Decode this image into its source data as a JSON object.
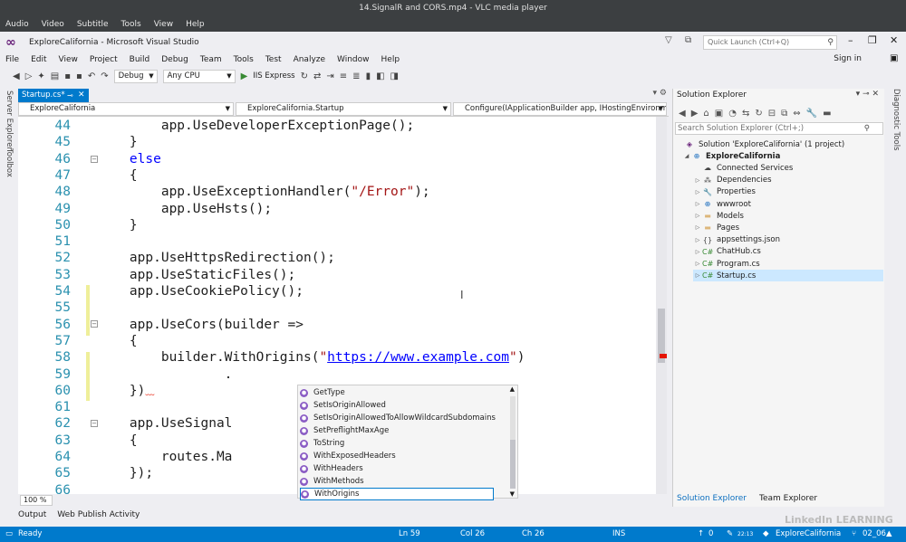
{
  "vlc": {
    "title": "14.SignalR and CORS.mp4 - VLC media player",
    "menu": [
      "Audio",
      "Video",
      "Subtitle",
      "Tools",
      "View",
      "Help"
    ]
  },
  "vs": {
    "title": "ExploreCalifornia - Microsoft Visual Studio",
    "quick_launch": "Quick Launch (Ctrl+Q)",
    "menu": [
      "File",
      "Edit",
      "View",
      "Project",
      "Build",
      "Debug",
      "Team",
      "Tools",
      "Test",
      "Analyze",
      "Window",
      "Help"
    ],
    "sign_in": "Sign in"
  },
  "toolbar": {
    "config": "Debug",
    "platform": "Any CPU",
    "run": "IIS Express"
  },
  "left_strip": [
    "Server Explorer",
    "Toolbox"
  ],
  "doc_tab": {
    "label": "Startup.cs*"
  },
  "nav": {
    "project": "ExploreCalifornia",
    "type": "ExploreCalifornia.Startup",
    "member": "Configure(IApplicationBuilder app, IHostingEnvironm"
  },
  "code_lines": [
    {
      "n": "44",
      "t": "        app.UseDeveloperExceptionPage();"
    },
    {
      "n": "45",
      "t": "    }"
    },
    {
      "n": "46",
      "t": "    else"
    },
    {
      "n": "47",
      "t": "    {"
    },
    {
      "n": "48",
      "t": "        app.UseExceptionHandler(\"/Error\");"
    },
    {
      "n": "49",
      "t": "        app.UseHsts();"
    },
    {
      "n": "50",
      "t": "    }"
    },
    {
      "n": "51",
      "t": ""
    },
    {
      "n": "52",
      "t": "    app.UseHttpsRedirection();"
    },
    {
      "n": "53",
      "t": "    app.UseStaticFiles();"
    },
    {
      "n": "54",
      "t": "    app.UseCookiePolicy();"
    },
    {
      "n": "55",
      "t": ""
    },
    {
      "n": "56",
      "t": "    app.UseCors(builder =>"
    },
    {
      "n": "57",
      "t": "    {"
    },
    {
      "n": "58",
      "t": "        builder.WithOrigins(\"https://www.example.com\")"
    },
    {
      "n": "59",
      "t": "                ."
    },
    {
      "n": "60",
      "t": "    })"
    },
    {
      "n": "61",
      "t": ""
    },
    {
      "n": "62",
      "t": "    app.UseSignal"
    },
    {
      "n": "63",
      "t": "    {"
    },
    {
      "n": "64",
      "t": "        routes.Ma"
    },
    {
      "n": "65",
      "t": "    });"
    },
    {
      "n": "66",
      "t": ""
    }
  ],
  "code_tokens": {
    "else": "else",
    "error_str": "\"/Error\"",
    "url_quote_open": "\"",
    "url": "https://www.example.com",
    "url_quote_close": "\""
  },
  "intellisense": {
    "items": [
      "GetType",
      "SetIsOriginAllowed",
      "SetIsOriginAllowedToAllowWildcardSubdomains",
      "SetPreflightMaxAge",
      "ToString",
      "WithExposedHeaders",
      "WithHeaders",
      "WithMethods",
      "WithOrigins"
    ],
    "selected": "WithOrigins"
  },
  "zoom": "100 %",
  "bottom_tabs": [
    "Output",
    "Web Publish Activity"
  ],
  "solution_explorer": {
    "title": "Solution Explorer",
    "search_placeholder": "Search Solution Explorer (Ctrl+;)",
    "tree": [
      {
        "label": "Solution 'ExploreCalifornia' (1 project)",
        "icon": "solution-icon",
        "bold": false
      },
      {
        "label": "ExploreCalifornia",
        "icon": "web-project-icon",
        "bold": true
      },
      {
        "label": "Connected Services",
        "icon": "connected-services-icon",
        "bold": false
      },
      {
        "label": "Dependencies",
        "icon": "dependencies-icon",
        "bold": false
      },
      {
        "label": "Properties",
        "icon": "wrench-icon",
        "bold": false
      },
      {
        "label": "wwwroot",
        "icon": "globe-icon",
        "bold": false
      },
      {
        "label": "Models",
        "icon": "folder-icon",
        "bold": false
      },
      {
        "label": "Pages",
        "icon": "folder-icon",
        "bold": false
      },
      {
        "label": "appsettings.json",
        "icon": "json-file-icon",
        "bold": false
      },
      {
        "label": "ChatHub.cs",
        "icon": "csharp-file-icon",
        "bold": false
      },
      {
        "label": "Program.cs",
        "icon": "csharp-file-icon",
        "bold": false
      },
      {
        "label": "Startup.cs",
        "icon": "csharp-file-icon",
        "bold": false
      }
    ],
    "tabs": [
      "Solution Explorer",
      "Team Explorer"
    ]
  },
  "right_strip": "Diagnostic Tools",
  "status": {
    "ready": "Ready",
    "ln": "Ln 59",
    "col": "Col 26",
    "ch": "Ch 26",
    "ins": "INS",
    "pending": "0",
    "project": "ExploreCalifornia",
    "branch": "02_06",
    "watermark": "LinkedIn LEARNING",
    "clock": "22:13"
  },
  "colors": {
    "accent": "#007acc",
    "keyword": "#0000ff",
    "string": "#a31515",
    "line_number": "#2b91af"
  }
}
